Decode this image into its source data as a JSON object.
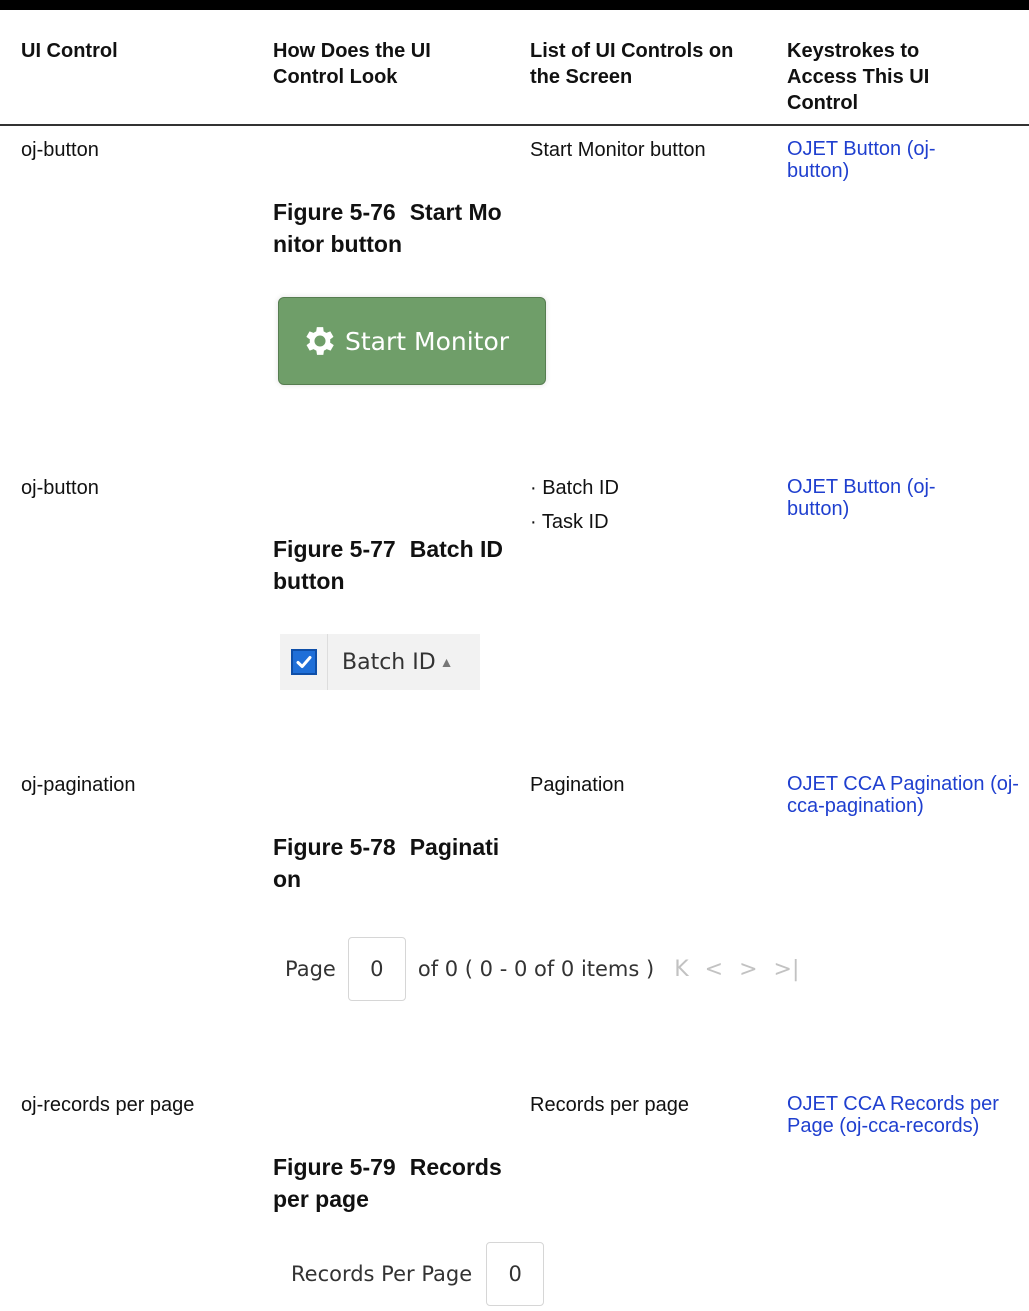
{
  "table": {
    "headers": [
      "UI Control",
      "How Does the UI Control Look",
      "List of UI Controls on the Screen",
      "Keystrokes to Access This UI Control"
    ],
    "rows": [
      {
        "ui_control": "oj-button",
        "figure_number": "Figure 5-76",
        "figure_title": "Start Monitor button",
        "figure_image": {
          "button_label": "Start Monitor",
          "icon": "gear-icon",
          "button_color": "#6f9e69"
        },
        "controls_list": [
          "Start Monitor button"
        ],
        "keystroke_link": "OJET Button (oj-button)"
      },
      {
        "ui_control": "oj-button",
        "figure_number": "Figure 5-77",
        "figure_title": "Batch ID button",
        "figure_image": {
          "label": "Batch ID",
          "checked": true,
          "icon": "checkbox-checked-icon",
          "sort_icon": "sort-ascending-icon",
          "checkbox_color": "#1f6fd8"
        },
        "controls_list": [
          "Batch ID",
          "Task ID"
        ],
        "keystroke_link": "OJET Button (oj-button)"
      },
      {
        "ui_control": "oj-pagination",
        "figure_number": "Figure 5-78",
        "figure_title": "Pagination",
        "figure_image": {
          "page_label": "Page",
          "page_value": "0",
          "summary": "of 0 ( 0 - 0 of 0 items )",
          "nav_icons": [
            "first-page-icon",
            "previous-page-icon",
            "next-page-icon",
            "last-page-icon"
          ]
        },
        "controls_list": [
          "Pagination"
        ],
        "keystroke_link": "OJET CCA Pagination (oj-cca-pagination)"
      },
      {
        "ui_control": "oj-records per page",
        "figure_number": "Figure 5-79",
        "figure_title": "Records per page",
        "figure_image": {
          "label": "Records Per Page",
          "value": "0"
        },
        "controls_list": [
          "Records per page"
        ],
        "keystroke_link": "OJET CCA Records per Page (oj-cca-records)"
      }
    ]
  },
  "colors": {
    "link": "#1f3fcf",
    "rule": "#000000"
  }
}
